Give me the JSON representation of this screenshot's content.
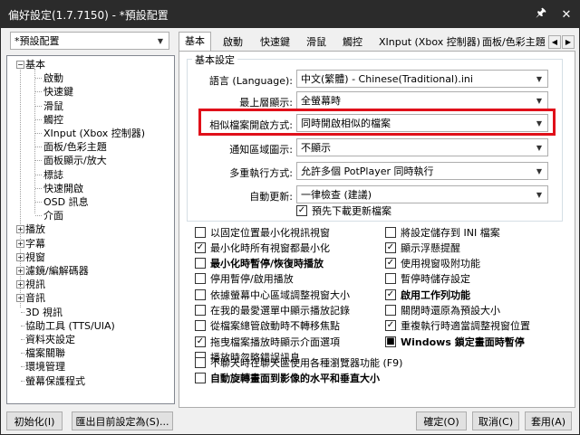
{
  "window": {
    "title": "偏好設定(1.7.7150) - *預設配置",
    "pin_glyph": "🖈",
    "close_glyph": "✕"
  },
  "profile_select": {
    "value": "*預設配置"
  },
  "tree": {
    "items": [
      {
        "label": "基本",
        "box": "−"
      },
      {
        "label": "啟動"
      },
      {
        "label": "快速鍵"
      },
      {
        "label": "滑鼠"
      },
      {
        "label": "觸控"
      },
      {
        "label": "XInput (Xbox 控制器)"
      },
      {
        "label": "面板/色彩主題"
      },
      {
        "label": "面板顯示/放大"
      },
      {
        "label": "標誌"
      },
      {
        "label": "快速開啟"
      },
      {
        "label": "OSD 訊息"
      },
      {
        "label": "介面"
      },
      {
        "label": "播放",
        "box": "+"
      },
      {
        "label": "字幕",
        "box": "+"
      },
      {
        "label": "視窗",
        "box": "+"
      },
      {
        "label": "濾鏡/編解碼器",
        "box": "+"
      },
      {
        "label": "視訊",
        "box": "+"
      },
      {
        "label": "音訊",
        "box": "+"
      },
      {
        "label": "3D 視訊"
      },
      {
        "label": "協助工具 (TTS/UIA)"
      },
      {
        "label": "資料夾設定"
      },
      {
        "label": "檔案關聯"
      },
      {
        "label": "環境管理"
      },
      {
        "label": "螢幕保護程式"
      }
    ]
  },
  "tabs": {
    "items": [
      "基本",
      "啟動",
      "快速鍵",
      "滑鼠",
      "觸控",
      "XInput (Xbox 控制器)",
      "面板/色彩主題"
    ],
    "active": "基本",
    "prev_glyph": "◀",
    "next_glyph": "▶"
  },
  "basic": {
    "group_label": "基本設定",
    "language": {
      "label": "語言 (Language):",
      "value": "中文(繁體) - Chinese(Traditional).ini"
    },
    "topmost": {
      "label": "最上層顯示:",
      "value": "全螢幕時"
    },
    "similar_open": {
      "label": "相似檔案開啟方式:",
      "value": "同時開啟相似的檔案"
    },
    "tray": {
      "label": "通知區域圖示:",
      "value": "不顯示"
    },
    "multi": {
      "label": "多重執行方式:",
      "value": "允許多個 PotPlayer 同時執行"
    },
    "update": {
      "label": "自動更新:",
      "value": "一律檢查 (建議)"
    },
    "predownload": {
      "label": "預先下載更新檔案",
      "checked": true
    }
  },
  "checkboxes_left": [
    {
      "label": "以固定位置最小化視訊視窗",
      "checked": false,
      "bold": false
    },
    {
      "label": "最小化時所有視窗都最小化",
      "checked": true,
      "bold": false
    },
    {
      "label": "最小化時暫停/恢復時播放",
      "checked": false,
      "bold": true
    },
    {
      "label": "停用暫停/啟用播放",
      "checked": false,
      "bold": false
    },
    {
      "label": "依據螢幕中心區域調整視窗大小",
      "checked": false,
      "bold": false
    },
    {
      "label": "在我的最愛選單中顯示播放記錄",
      "checked": false,
      "bold": false
    },
    {
      "label": "從檔案總管啟動時不轉移焦點",
      "checked": false,
      "bold": false
    },
    {
      "label": "拖曳檔案播放時顯示介面選項",
      "checked": true,
      "bold": false
    },
    {
      "label": "播放時忽略錯誤訊息",
      "checked": false,
      "bold": false
    }
  ],
  "checkboxes_right": [
    {
      "label": "將設定儲存到 INI 檔案",
      "checked": false,
      "bold": false,
      "mark": "✓"
    },
    {
      "label": "顯示浮懸提醒",
      "checked": true,
      "bold": false,
      "mark": "✓"
    },
    {
      "label": "使用視窗吸附功能",
      "checked": true,
      "bold": false,
      "mark": "✓"
    },
    {
      "label": "暫停時儲存設定",
      "checked": false,
      "bold": false,
      "mark": "✓"
    },
    {
      "label": "啟用工作列功能",
      "checked": true,
      "bold": true,
      "mark": "✓"
    },
    {
      "label": "關閉時還原為預設大小",
      "checked": false,
      "bold": false,
      "mark": "✓"
    },
    {
      "label": "重複執行時適當調整視窗位置",
      "checked": true,
      "bold": false,
      "mark": "✓"
    },
    {
      "label": "Windows 鎖定畫面時暫停",
      "checked": true,
      "bold": true,
      "mark": "■"
    }
  ],
  "checkboxes_bottom": [
    {
      "label": "不聊天時在聊天區使用各種瀏覽器功能 (F9)",
      "checked": false,
      "bold": false
    },
    {
      "label": "自動旋轉畫面到影像的水平和垂直大小",
      "checked": false,
      "bold": true
    }
  ],
  "check_mark": "✓",
  "combo_arrow": "▼",
  "footer": {
    "init_label": "初始化(I)",
    "export_label": "匯出目前設定為(S)...",
    "ok_label": "確定(O)",
    "cancel_label": "取消(C)",
    "apply_label": "套用(A)"
  }
}
